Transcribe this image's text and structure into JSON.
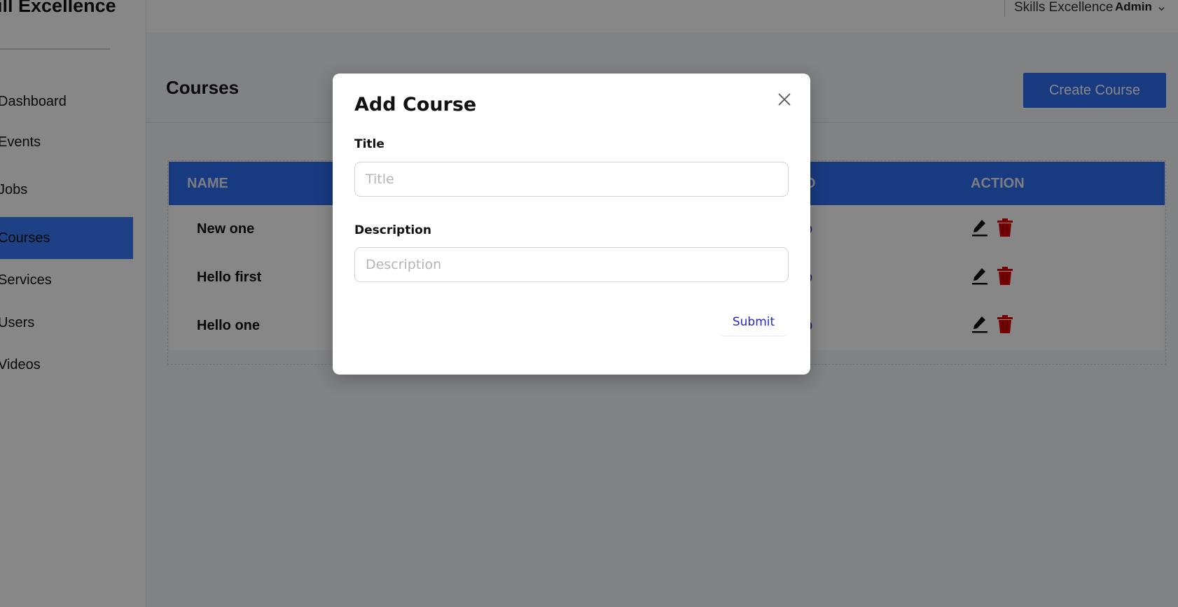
{
  "sidebar": {
    "brand": "ill Excellence",
    "items": [
      {
        "label": "Dashboard",
        "active": false
      },
      {
        "label": "Events",
        "active": false
      },
      {
        "label": "Jobs",
        "active": false
      },
      {
        "label": "Courses",
        "active": true
      },
      {
        "label": "Services",
        "active": false
      },
      {
        "label": "Users",
        "active": false
      },
      {
        "label": "Videos",
        "active": false
      }
    ]
  },
  "topbar": {
    "org_name": "Skills Excellence",
    "user_label": "Admin",
    "user_menu_icon": "chevron-down-icon"
  },
  "page": {
    "title": "Courses",
    "create_button": "Create Course"
  },
  "table": {
    "columns": [
      "NAME",
      "O",
      "ACTION"
    ],
    "rows": [
      {
        "name": "New one",
        "link_fragment": "o"
      },
      {
        "name": "Hello first",
        "link_fragment": "o"
      },
      {
        "name": "Hello one",
        "link_fragment": "o"
      }
    ],
    "action_icons": [
      "pencil-icon",
      "trash-icon"
    ]
  },
  "modal": {
    "title": "Add Course",
    "close_icon": "close-icon",
    "title_label": "Title",
    "title_placeholder": "Title",
    "title_value": "",
    "description_label": "Description",
    "description_placeholder": "Description",
    "description_value": "",
    "submit_label": "Submit"
  },
  "colors": {
    "accent_blue": "#2f6ff1",
    "delete_red": "#e00000",
    "link_blue": "#2525c9",
    "overlay": "rgba(0,0,0,0.47)"
  }
}
